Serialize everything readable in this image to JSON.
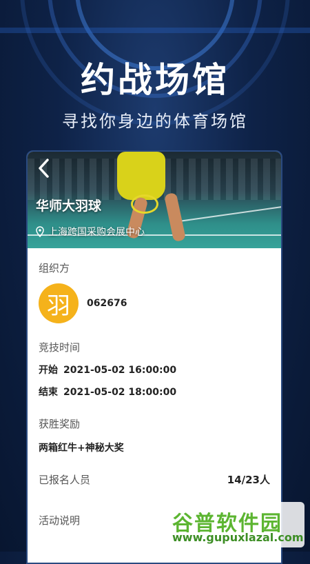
{
  "header": {
    "title": "约战场馆",
    "subtitle": "寻找你身边的体育场馆"
  },
  "venue": {
    "name": "华师大羽球",
    "location": "上海跨国采购会展中心"
  },
  "organizer": {
    "label": "组织方",
    "avatar_text": "羽",
    "id": "062676",
    "avatar_color": "#f5b21b"
  },
  "time": {
    "label": "竞技时间",
    "start_label": "开始",
    "start_value": "2021-05-02 16:00:00",
    "end_label": "结束",
    "end_value": "2021-05-02 18:00:00"
  },
  "reward": {
    "label": "获胜奖励",
    "value": "两箱红牛+神秘大奖"
  },
  "enrolled": {
    "label": "已报名人员",
    "count": "14/23人"
  },
  "description": {
    "label": "活动说明"
  },
  "watermark": {
    "cn": "谷普软件园",
    "en": "www.gupuxlazal.com"
  },
  "icons": {
    "back": "chevron-left-icon",
    "location": "location-pin-icon"
  }
}
